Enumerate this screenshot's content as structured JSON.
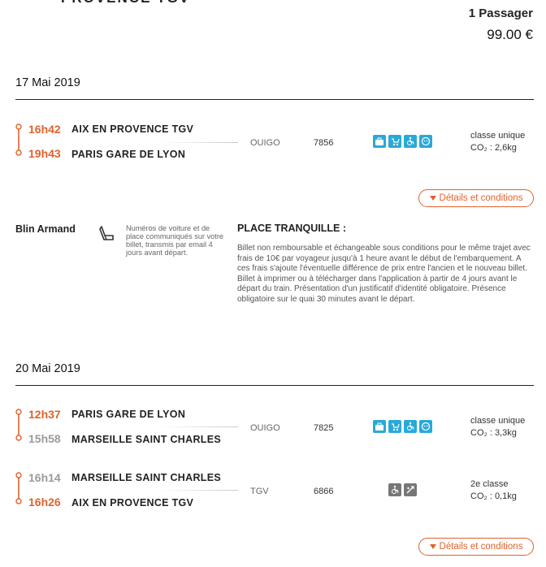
{
  "header": {
    "cut_title": "PROVENCE TGV",
    "passengers": "1 Passager",
    "price": "99.00 €"
  },
  "journeys": [
    {
      "date": "17 Mai 2019",
      "segments": [
        {
          "depart_time": "16h42",
          "depart_station": "AIX EN PROVENCE TGV",
          "arrive_time": "19h43",
          "arrive_station": "PARIS GARE DE LYON",
          "carrier": "OUIGO",
          "train": "7856",
          "icons": [
            "luggage-icon",
            "stroller-icon",
            "wheelchair-icon",
            "kids-icon"
          ],
          "class": "classe unique",
          "co2": "CO₂ : 2,6kg"
        }
      ],
      "details_label": "Détails et conditions"
    },
    {
      "date": "20 Mai 2019",
      "segments": [
        {
          "depart_time": "12h37",
          "depart_station": "PARIS GARE DE LYON",
          "arrive_time": "15h58",
          "arrive_station": "MARSEILLE SAINT CHARLES",
          "carrier": "OUIGO",
          "train": "7825",
          "icons": [
            "luggage-icon",
            "stroller-icon",
            "wheelchair-icon",
            "kids-icon"
          ],
          "class": "classe unique",
          "co2": "CO₂ : 3,3kg"
        },
        {
          "depart_time": "16h14",
          "depart_station": "MARSEILLE SAINT CHARLES",
          "arrive_time": "16h26",
          "arrive_station": "AIX EN PROVENCE TGV",
          "carrier": "TGV",
          "train": "6866",
          "icons": [
            "wheelchair-icon",
            "bike-icon"
          ],
          "class": "2e classe",
          "co2": "CO₂ : 0,1kg"
        }
      ],
      "details_label": "Détails et conditions"
    }
  ],
  "passenger": {
    "name": "Blin Armand",
    "seat_note": "Numéros de voiture et de place communiqués sur votre billet, transmis par email 4 jours avant départ.",
    "fare_name": "PLACE TRANQUILLE :",
    "conditions": "Billet non remboursable et échangeable sous conditions pour le même trajet avec frais de 10€ par voyageur jusqu'à 1 heure avant le début de l'embarquement. A ces frais s'ajoute l'éventuelle différence de prix entre l'ancien et le nouveau billet. Billet à imprimer ou à télécharger dans l'application à partir de 4 jours avant le départ du train. Présentation d'un justificatif d'identité obligatoire. Présence obligatoire sur le quai 30 minutes avant le départ."
  },
  "colors": {
    "accent": "#e0622a",
    "icon_blue": "#2aa9d8",
    "icon_gray": "#777777"
  }
}
